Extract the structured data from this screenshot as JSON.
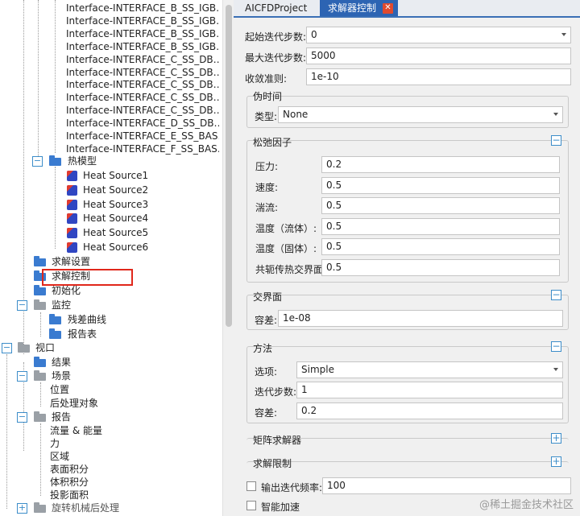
{
  "tree": {
    "interface_items": [
      "Interface-INTERFACE_B_SS_IGB…",
      "Interface-INTERFACE_B_SS_IGB…",
      "Interface-INTERFACE_B_SS_IGB…",
      "Interface-INTERFACE_B_SS_IGB…",
      "Interface-INTERFACE_C_SS_DB…",
      "Interface-INTERFACE_C_SS_DB…",
      "Interface-INTERFACE_C_SS_DB…",
      "Interface-INTERFACE_C_SS_DB…",
      "Interface-INTERFACE_C_SS_DB…",
      "Interface-INTERFACE_D_SS_DB…",
      "Interface-INTERFACE_E_SS_BAS…",
      "Interface-INTERFACE_F_SS_BAS…"
    ],
    "thermal_model": "热模型",
    "heat_sources": [
      "Heat Source1",
      "Heat Source2",
      "Heat Source3",
      "Heat Source4",
      "Heat Source5",
      "Heat Source6"
    ],
    "solve_settings": "求解设置",
    "solve_control": "求解控制",
    "initialize": "初始化",
    "monitor": "监控",
    "residual_curve": "残差曲线",
    "report_table": "报告表",
    "view": "视口",
    "results": "结果",
    "scene": "场景",
    "position": "位置",
    "post_object": "后处理对象",
    "report": "报告",
    "flow_energy": "流量 & 能量",
    "force": "力",
    "region": "区域",
    "surface_integral": "表面积分",
    "volume_integral": "体积积分",
    "projected_area": "投影面积",
    "rotating_post": "旋转机械后处理"
  },
  "tabs": {
    "project": "AICFDProject",
    "active": "求解器控制",
    "close": "✕"
  },
  "form": {
    "start_iter_label": "起始迭代步数:",
    "start_iter_value": "0",
    "max_iter_label": "最大迭代步数:",
    "max_iter_value": "5000",
    "convergence_label": "收敛准则:",
    "convergence_value": "1e-10"
  },
  "pseudo_time": {
    "title": "伪时间",
    "type_label": "类型:",
    "type_value": "None"
  },
  "relaxation": {
    "title": "松弛因子",
    "toggle": "−",
    "fields": [
      {
        "label": "压力:",
        "value": "0.2"
      },
      {
        "label": "速度:",
        "value": "0.5"
      },
      {
        "label": "湍流:",
        "value": "0.5"
      },
      {
        "label": "温度（流体）:",
        "value": "0.5"
      },
      {
        "label": "温度（固体）:",
        "value": "0.5"
      },
      {
        "label": "共轭传热交界面:",
        "value": "0.5"
      }
    ]
  },
  "interface": {
    "title": "交界面",
    "toggle": "−",
    "tolerance_label": "容差:",
    "tolerance_value": "1e-08"
  },
  "method": {
    "title": "方法",
    "toggle": "−",
    "option_label": "选项:",
    "option_value": "Simple",
    "iter_label": "迭代步数:",
    "iter_value": "1",
    "tol_label": "容差:",
    "tol_value": "0.2"
  },
  "matrix_solver": {
    "title": "矩阵求解器",
    "toggle": "+"
  },
  "solve_limit": {
    "title": "求解限制",
    "toggle": "+"
  },
  "output_freq": {
    "label": "输出迭代频率:",
    "value": "100"
  },
  "smart_accel": {
    "label": "智能加速"
  },
  "watermark": "@稀土掘金技术社区"
}
